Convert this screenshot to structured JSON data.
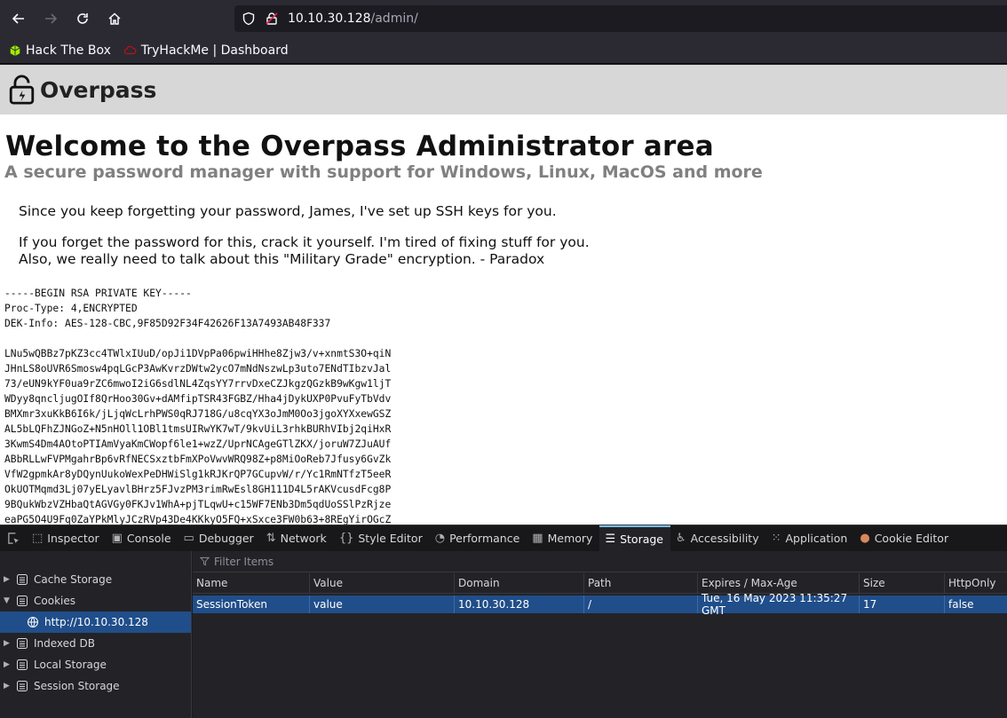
{
  "browser": {
    "url_host": "10.10.30.128",
    "url_path": "/admin/",
    "bookmarks": [
      {
        "label": "Hack The Box"
      },
      {
        "label": "TryHackMe | Dashboard"
      }
    ]
  },
  "page": {
    "site_name": "Overpass",
    "title": "Welcome to the Overpass Administrator area",
    "subtitle": "A secure password manager with support for Windows, Linux, MacOS and more",
    "message1": "Since you keep forgetting your password, James, I've set up SSH keys for you.",
    "message2_line1": "If you forget the password for this, crack it yourself. I'm tired of fixing stuff for you.",
    "message2_line2": "Also, we really need to talk about this \"Military Grade\" encryption. - Paradox",
    "key_header": [
      "-----BEGIN RSA PRIVATE KEY-----",
      "Proc-Type: 4,ENCRYPTED",
      "DEK-Info: AES-128-CBC,9F85D92F34F42626F13A7493AB48F337"
    ],
    "key_lines": [
      "LNu5wQBBz7pKZ3cc4TWlxIUuD/opJi1DVpPa06pwiHHhe8Zjw3/v+xnmtS3O+qiN",
      "JHnLS8oUVR6Smosw4pqLGcP3AwKvrzDWtw2ycO7mNdNszwLp3uto7ENdTIbzvJal",
      "73/eUN9kYF0ua9rZC6mwoI2iG6sdlNL4ZqsYY7rrvDxeCZJkgzQGzkB9wKgw1ljT",
      "WDyy8qncljugOIf8QrHoo30Gv+dAMfipTSR43FGBZ/Hha4jDykUXP0PvuFyTbVdv",
      "BMXmr3xuKkB6I6k/jLjqWcLrhPWS0qRJ718G/u8cqYX3oJmM0Oo3jgoXYXxewGSZ",
      "AL5bLQFhZJNGoZ+N5nHOll1OBl1tmsUIRwYK7wT/9kvUiL3rhkBURhVIbj2qiHxR",
      "3KwmS4Dm4AOtoPTIAmVyaKmCWopf6le1+wzZ/UprNCAgeGTlZKX/joruW7ZJuAUf",
      "ABbRLLwFVPMgahrBp6vRfNECSxztbFmXPoVwvWRQ98Z+p8MiOoReb7Jfusy6GvZk",
      "VfW2gpmkAr8yDQynUukoWexPeDHWiSlg1kRJKrQP7GCupvW/r/Yc1RmNTfzT5eeR",
      "OkUOTMqmd3Lj07yELyavlBHrz5FJvzPM3rimRwEsl8GH111D4L5rAKVcusdFcg8P",
      "9BQukWbzVZHbaQtAGVGy0FKJv1WhA+pjTLqwU+c15WF7ENb3Dm5qdUoSSlPzRjze",
      "eaPG5O4U9Fq0ZaYPkMlyJCzRVp43De4KKkyO5FQ+xSxce3FW0b63+8REgYirOGcZ"
    ]
  },
  "devtools": {
    "tabs": [
      {
        "label": "Inspector",
        "icon": "inspector-icon"
      },
      {
        "label": "Console",
        "icon": "console-icon"
      },
      {
        "label": "Debugger",
        "icon": "debugger-icon"
      },
      {
        "label": "Network",
        "icon": "network-icon"
      },
      {
        "label": "Style Editor",
        "icon": "style-editor-icon"
      },
      {
        "label": "Performance",
        "icon": "performance-icon"
      },
      {
        "label": "Memory",
        "icon": "memory-icon"
      },
      {
        "label": "Storage",
        "icon": "storage-icon",
        "active": true
      },
      {
        "label": "Accessibility",
        "icon": "accessibility-icon"
      },
      {
        "label": "Application",
        "icon": "application-icon"
      },
      {
        "label": "Cookie Editor",
        "icon": "cookie-icon"
      }
    ],
    "tree": {
      "cache_storage": "Cache Storage",
      "cookies": "Cookies",
      "cookie_host": "http://10.10.30.128",
      "indexed_db": "Indexed DB",
      "local_storage": "Local Storage",
      "session_storage": "Session Storage"
    },
    "filter_placeholder": "Filter Items",
    "columns": [
      "Name",
      "Value",
      "Domain",
      "Path",
      "Expires / Max-Age",
      "Size",
      "HttpOnly"
    ],
    "rows": [
      [
        "SessionToken",
        "value",
        "10.10.30.128",
        "/",
        "Tue, 16 May 2023 11:35:27 GMT",
        "17",
        "false"
      ]
    ]
  }
}
